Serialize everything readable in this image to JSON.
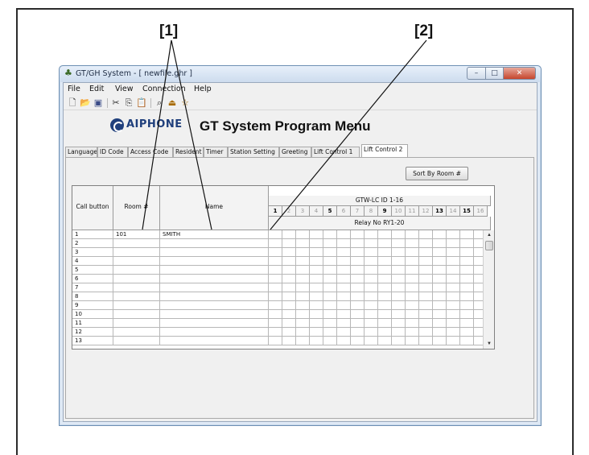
{
  "callouts": {
    "c1": "[1]",
    "c2": "[2]"
  },
  "window": {
    "title": "GT/GH System - [ newfile.ghr ]",
    "controls": {
      "minimize": "–",
      "maximize": "□",
      "close": "✕"
    }
  },
  "menu": {
    "file": "File",
    "edit": "Edit",
    "view": "View",
    "connection": "Connection",
    "help": "Help"
  },
  "toolbar_icons": [
    "new-file-icon",
    "open-folder-icon",
    "save-icon",
    "cut-icon",
    "copy-icon",
    "paste-icon",
    "find-icon",
    "upload-icon",
    "download-icon"
  ],
  "header": {
    "brand": "AIPHONE",
    "title": "GT System Program Menu"
  },
  "tabs": [
    {
      "label": "Language",
      "active": false
    },
    {
      "label": "ID Code",
      "active": false
    },
    {
      "label": "Access Code",
      "active": false
    },
    {
      "label": "Resident",
      "active": false
    },
    {
      "label": "Timer",
      "active": false
    },
    {
      "label": "Station Setting",
      "active": false
    },
    {
      "label": "Greeting",
      "active": false
    },
    {
      "label": "Lift Control 1",
      "active": false
    },
    {
      "label": "Lift Control 2",
      "active": true
    }
  ],
  "sort_button": "Sort By Room #",
  "grid": {
    "col_call_button": "Call button",
    "col_room": "Room #",
    "col_name": "Name",
    "gtw_header": "GTW-LC ID 1-16",
    "relay_header": "Relay No RY1-20",
    "ids": [
      "1",
      "2",
      "3",
      "4",
      "5",
      "6",
      "7",
      "8",
      "9",
      "10",
      "11",
      "12",
      "13",
      "14",
      "15",
      "16"
    ],
    "id_enabled": [
      true,
      false,
      false,
      false,
      true,
      false,
      false,
      false,
      true,
      false,
      false,
      false,
      true,
      false,
      true,
      false
    ],
    "rows": [
      {
        "call": "1",
        "room": "101",
        "name": "SMITH"
      },
      {
        "call": "2",
        "room": "",
        "name": ""
      },
      {
        "call": "3",
        "room": "",
        "name": ""
      },
      {
        "call": "4",
        "room": "",
        "name": ""
      },
      {
        "call": "5",
        "room": "",
        "name": ""
      },
      {
        "call": "6",
        "room": "",
        "name": ""
      },
      {
        "call": "7",
        "room": "",
        "name": ""
      },
      {
        "call": "8",
        "room": "",
        "name": ""
      },
      {
        "call": "9",
        "room": "",
        "name": ""
      },
      {
        "call": "10",
        "room": "",
        "name": ""
      },
      {
        "call": "11",
        "room": "",
        "name": ""
      },
      {
        "call": "12",
        "room": "",
        "name": ""
      },
      {
        "call": "13",
        "room": "",
        "name": ""
      }
    ]
  },
  "colors": {
    "brand": "#1f3f7c",
    "close_button": "#c6452d",
    "window_border": "#6d8fb3"
  }
}
